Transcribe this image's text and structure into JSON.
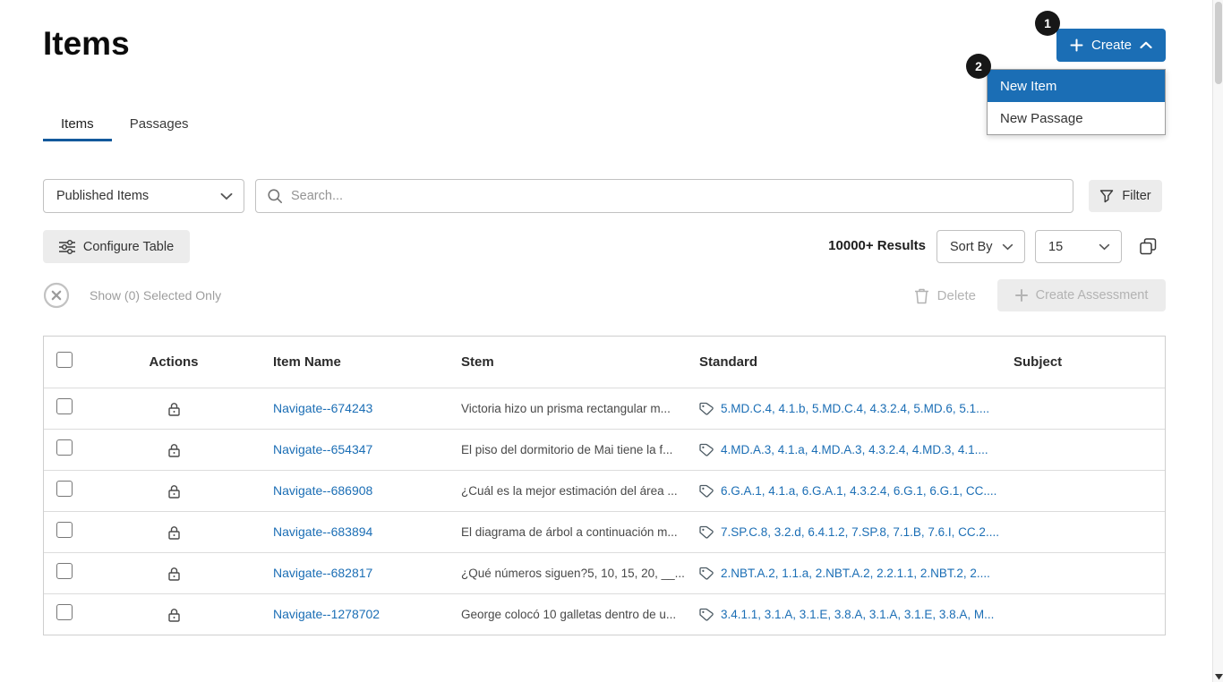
{
  "page": {
    "title": "Items"
  },
  "badges": {
    "one": "1",
    "two": "2"
  },
  "create_button": {
    "label": "Create"
  },
  "create_menu": {
    "items": [
      {
        "label": "New Item",
        "selected": true
      },
      {
        "label": "New Passage",
        "selected": false
      }
    ]
  },
  "tabs": [
    {
      "label": "Items",
      "active": true
    },
    {
      "label": "Passages",
      "active": false
    }
  ],
  "toolbar": {
    "published_filter": "Published Items",
    "search_placeholder": "Search...",
    "filter_label": "Filter",
    "configure_table": "Configure Table",
    "results": "10000+ Results",
    "sort_by": "Sort By",
    "page_size": "15"
  },
  "selection": {
    "show_selected": "Show (0) Selected Only",
    "delete": "Delete",
    "create_assessment": "Create Assessment"
  },
  "table": {
    "headers": {
      "actions": "Actions",
      "item_name": "Item Name",
      "stem": "Stem",
      "standard": "Standard",
      "subject": "Subject"
    },
    "rows": [
      {
        "item_name": "Navigate--674243",
        "stem": "Victoria hizo un prisma rectangular m...",
        "standard": "5.MD.C.4, 4.1.b, 5.MD.C.4, 4.3.2.4, 5.MD.6, 5.1....",
        "subject": ""
      },
      {
        "item_name": "Navigate--654347",
        "stem": "El piso del dormitorio de Mai tiene la f...",
        "standard": "4.MD.A.3, 4.1.a, 4.MD.A.3, 4.3.2.4, 4.MD.3, 4.1....",
        "subject": ""
      },
      {
        "item_name": "Navigate--686908",
        "stem": "¿Cuál es la mejor estimación del área ...",
        "standard": "6.G.A.1, 4.1.a, 6.G.A.1, 4.3.2.4, 6.G.1, 6.G.1, CC....",
        "subject": ""
      },
      {
        "item_name": "Navigate--683894",
        "stem": "El diagrama de árbol a continuación m...",
        "standard": "7.SP.C.8, 3.2.d, 6.4.1.2, 7.SP.8, 7.1.B, 7.6.I, CC.2....",
        "subject": ""
      },
      {
        "item_name": "Navigate--682817",
        "stem": "¿Qué números siguen?5, 10, 15, 20, __...",
        "standard": "2.NBT.A.2, 1.1.a, 2.NBT.A.2, 2.2.1.1, 2.NBT.2, 2....",
        "subject": ""
      },
      {
        "item_name": "Navigate--1278702",
        "stem": "George colocó 10 galletas dentro de u...",
        "standard": "3.4.1.1, 3.1.A, 3.1.E, 3.8.A, 3.1.A, 3.1.E, 3.8.A, M...",
        "subject": ""
      }
    ]
  },
  "colors": {
    "accent": "#1b6eb5",
    "link": "#1b6eb5",
    "tab_underline": "#13599c",
    "button_gray": "#ececec",
    "disabled_text": "#b3b3b3",
    "badge_bg": "#171717"
  },
  "icons": {
    "create": "plus",
    "create_chevron": "chevron-up",
    "dropdowns": "chevron-down",
    "search": "magnifier",
    "filter": "funnel",
    "configure_table": "sliders",
    "duplicate": "copy",
    "clear_selection": "circle-x",
    "delete": "trash",
    "create_assessment": "plus",
    "row_actions": "padlock",
    "standard": "tag"
  }
}
